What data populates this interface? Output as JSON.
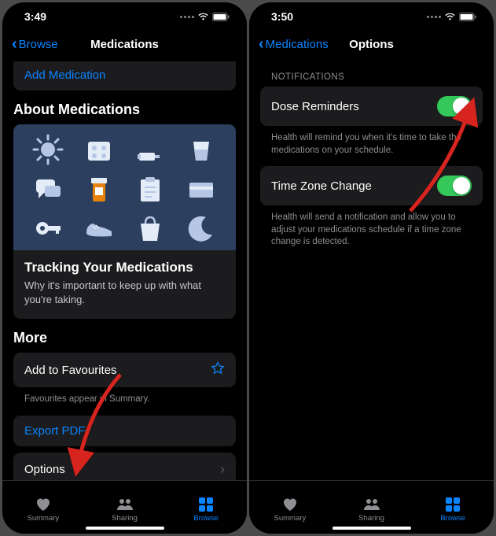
{
  "left": {
    "status": {
      "time": "3:49"
    },
    "nav": {
      "back": "Browse",
      "title": "Medications"
    },
    "addMedication": "Add Medication",
    "aboutTitle": "About Medications",
    "card": {
      "title": "Tracking Your Medications",
      "sub": "Why it's important to keep up with what you're taking."
    },
    "moreTitle": "More",
    "favourites": "Add to Favourites",
    "favFooter": "Favourites appear in Summary.",
    "exportPdf": "Export PDF",
    "options": "Options"
  },
  "right": {
    "status": {
      "time": "3:50"
    },
    "nav": {
      "back": "Medications",
      "title": "Options"
    },
    "notificationsHeader": "NOTIFICATIONS",
    "doseReminders": "Dose Reminders",
    "doseFooter": "Health will remind you when it's time to take the medications on your schedule.",
    "timeZone": "Time Zone Change",
    "timeZoneFooter": "Health will send a notification and allow you to adjust your medications schedule if a time zone change is detected."
  },
  "tabs": {
    "summary": "Summary",
    "sharing": "Sharing",
    "browse": "Browse"
  }
}
